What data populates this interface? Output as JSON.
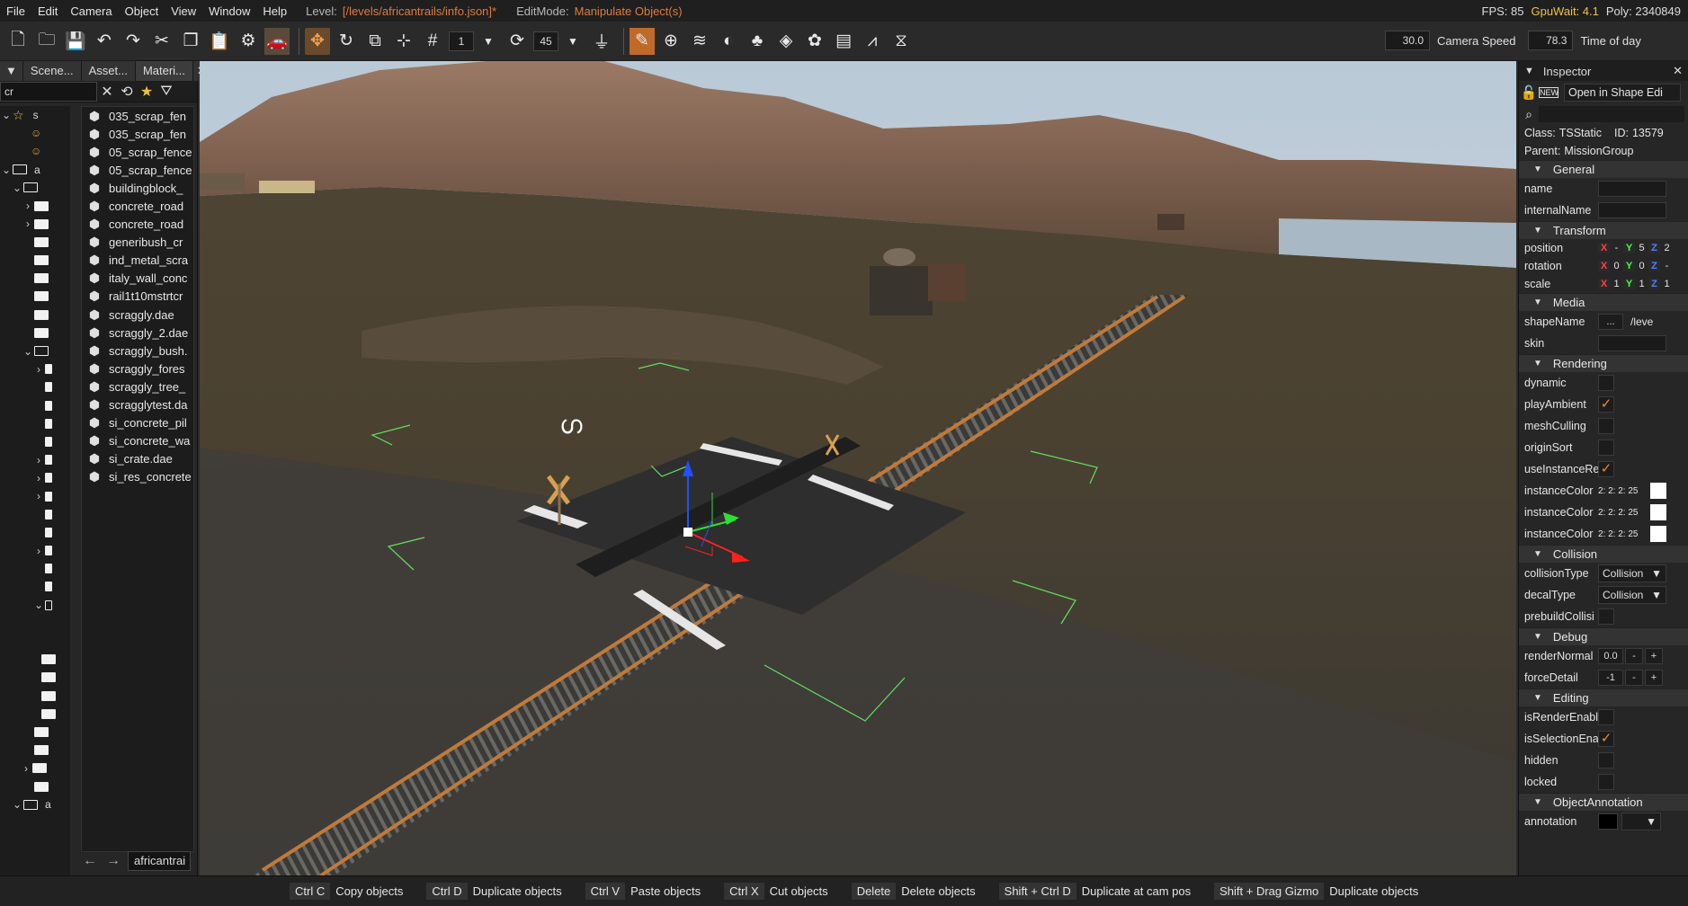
{
  "menubar": {
    "items": [
      "File",
      "Edit",
      "Camera",
      "Object",
      "View",
      "Window",
      "Help"
    ],
    "level_label": "Level:",
    "level_value": "[/levels/africantrails/info.json]*",
    "editmode_label": "EditMode:",
    "editmode_value": "Manipulate Object(s)",
    "fps": "FPS: 85",
    "gpuwait": "GpuWait: 4.1",
    "poly": "Poly: 2340849"
  },
  "toolbar": {
    "snap_value": "1",
    "rot_value": "45",
    "camera_speed_value": "30.0",
    "camera_speed_label": "Camera Speed",
    "time_value": "78.3",
    "time_label": "Time of day"
  },
  "leftpanel": {
    "tabs": [
      "Scene...",
      "Asset...",
      "Materi..."
    ],
    "filter": "cr",
    "tree_labels": [
      "s",
      "a"
    ],
    "files": [
      "035_scrap_fen",
      "035_scrap_fen",
      "05_scrap_fence",
      "05_scrap_fence",
      "buildingblock_",
      "concrete_road",
      "concrete_road",
      "generibush_cr",
      "ind_metal_scra",
      "italy_wall_conc",
      "rail1t10mstrtcr",
      "scraggly.dae",
      "scraggly_2.dae",
      "scraggly_bush.",
      "scraggly_fores",
      "scraggly_tree_",
      "scragglytest.da",
      "si_concrete_pil",
      "si_concrete_wa",
      "si_crate.dae",
      "si_res_concrete"
    ],
    "path": "africantrai"
  },
  "inspector": {
    "title": "Inspector",
    "open_btn": "Open in Shape Edi",
    "class_label": "Class:",
    "class_value": "TSStatic",
    "id_label": "ID:",
    "id_value": "13579",
    "parent_label": "Parent:",
    "parent_value": "MissionGroup",
    "sections": {
      "general": "General",
      "transform": "Transform",
      "media": "Media",
      "rendering": "Rendering",
      "collision": "Collision",
      "debug": "Debug",
      "editing": "Editing",
      "annotation": "ObjectAnnotation"
    },
    "fields": {
      "name": "name",
      "internalName": "internalName",
      "position": "position",
      "rotation": "rotation",
      "scale": "scale",
      "shapeName": "shapeName",
      "shapeName_btn": "...",
      "shapeName_val": "/leve",
      "skin": "skin",
      "dynamic": "dynamic",
      "playAmbient": "playAmbient",
      "meshCulling": "meshCulling",
      "originSort": "originSort",
      "useInstanceRe": "useInstanceRe",
      "instanceColor": "instanceColor",
      "instanceColor1": "instanceColor",
      "instanceColor2": "instanceColor",
      "color_vals": "2: 2: 2: 25",
      "collisionType": "collisionType",
      "collisionType_val": "Collision",
      "decalType": "decalType",
      "decalType_val": "Collision",
      "prebuildCollisi": "prebuildCollisi",
      "renderNormal": "renderNormal",
      "renderNormal_val": "0.0",
      "forceDetail": "forceDetail",
      "forceDetail_val": "-1",
      "isRenderEnabl": "isRenderEnabl",
      "isSelectionEna": "isSelectionEna",
      "hidden": "hidden",
      "locked": "locked",
      "annotation": "annotation"
    },
    "pos_vals": [
      "X",
      "-",
      "Y",
      "5",
      "Z",
      "2"
    ],
    "rot_vals": [
      "X",
      "0",
      "Y",
      "0",
      "Z",
      "-"
    ],
    "scale_vals": [
      "X",
      "1",
      "Y",
      "1",
      "Z",
      "1"
    ]
  },
  "statusbar": [
    {
      "key": "Ctrl C",
      "desc": "Copy objects"
    },
    {
      "key": "Ctrl D",
      "desc": "Duplicate objects"
    },
    {
      "key": "Ctrl V",
      "desc": "Paste objects"
    },
    {
      "key": "Ctrl X",
      "desc": "Cut objects"
    },
    {
      "key": "Delete",
      "desc": "Delete objects"
    },
    {
      "key": "Shift + Ctrl D",
      "desc": "Duplicate at cam pos"
    },
    {
      "key": "Shift + Drag Gizmo",
      "desc": "Duplicate objects"
    }
  ],
  "colors": {
    "accent_orange": "#e07a3a",
    "fps_yellow": "#f0c040",
    "axis_x": "#ff4040",
    "axis_y": "#40ff40",
    "axis_z": "#5080ff"
  }
}
